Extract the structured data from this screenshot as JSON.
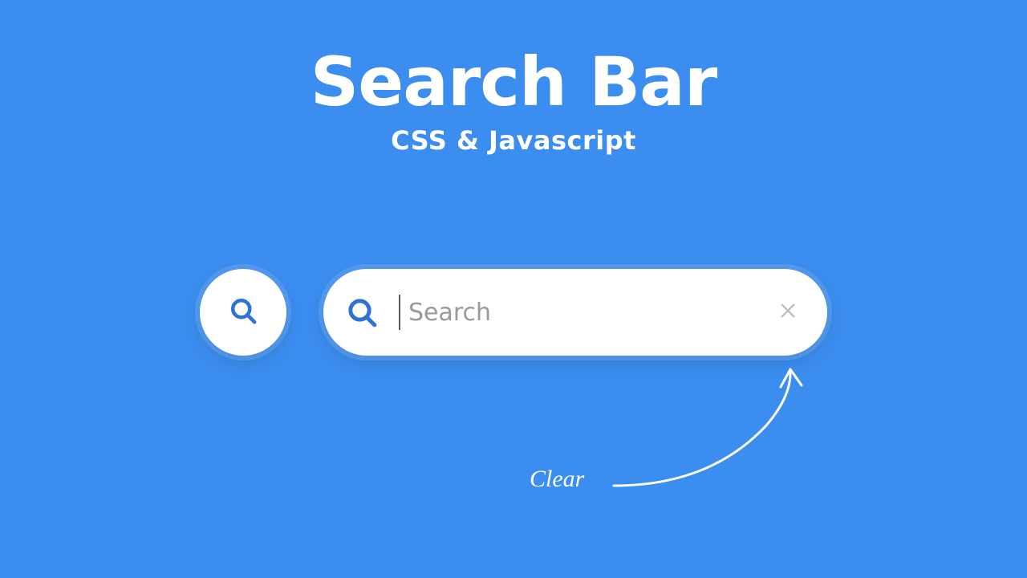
{
  "title": "Search Bar",
  "subtitle": "CSS & Javascript",
  "search": {
    "placeholder": "Search",
    "value": ""
  },
  "annotation": "Clear",
  "colors": {
    "background": "#3b8def",
    "accent": "#2d72d9",
    "surface": "#ffffff",
    "placeholder": "#9a9a9a",
    "close_icon": "#bdbdbd"
  },
  "icons": {
    "search_collapsed": "search-icon",
    "search_expanded": "search-icon",
    "clear": "close-icon"
  }
}
